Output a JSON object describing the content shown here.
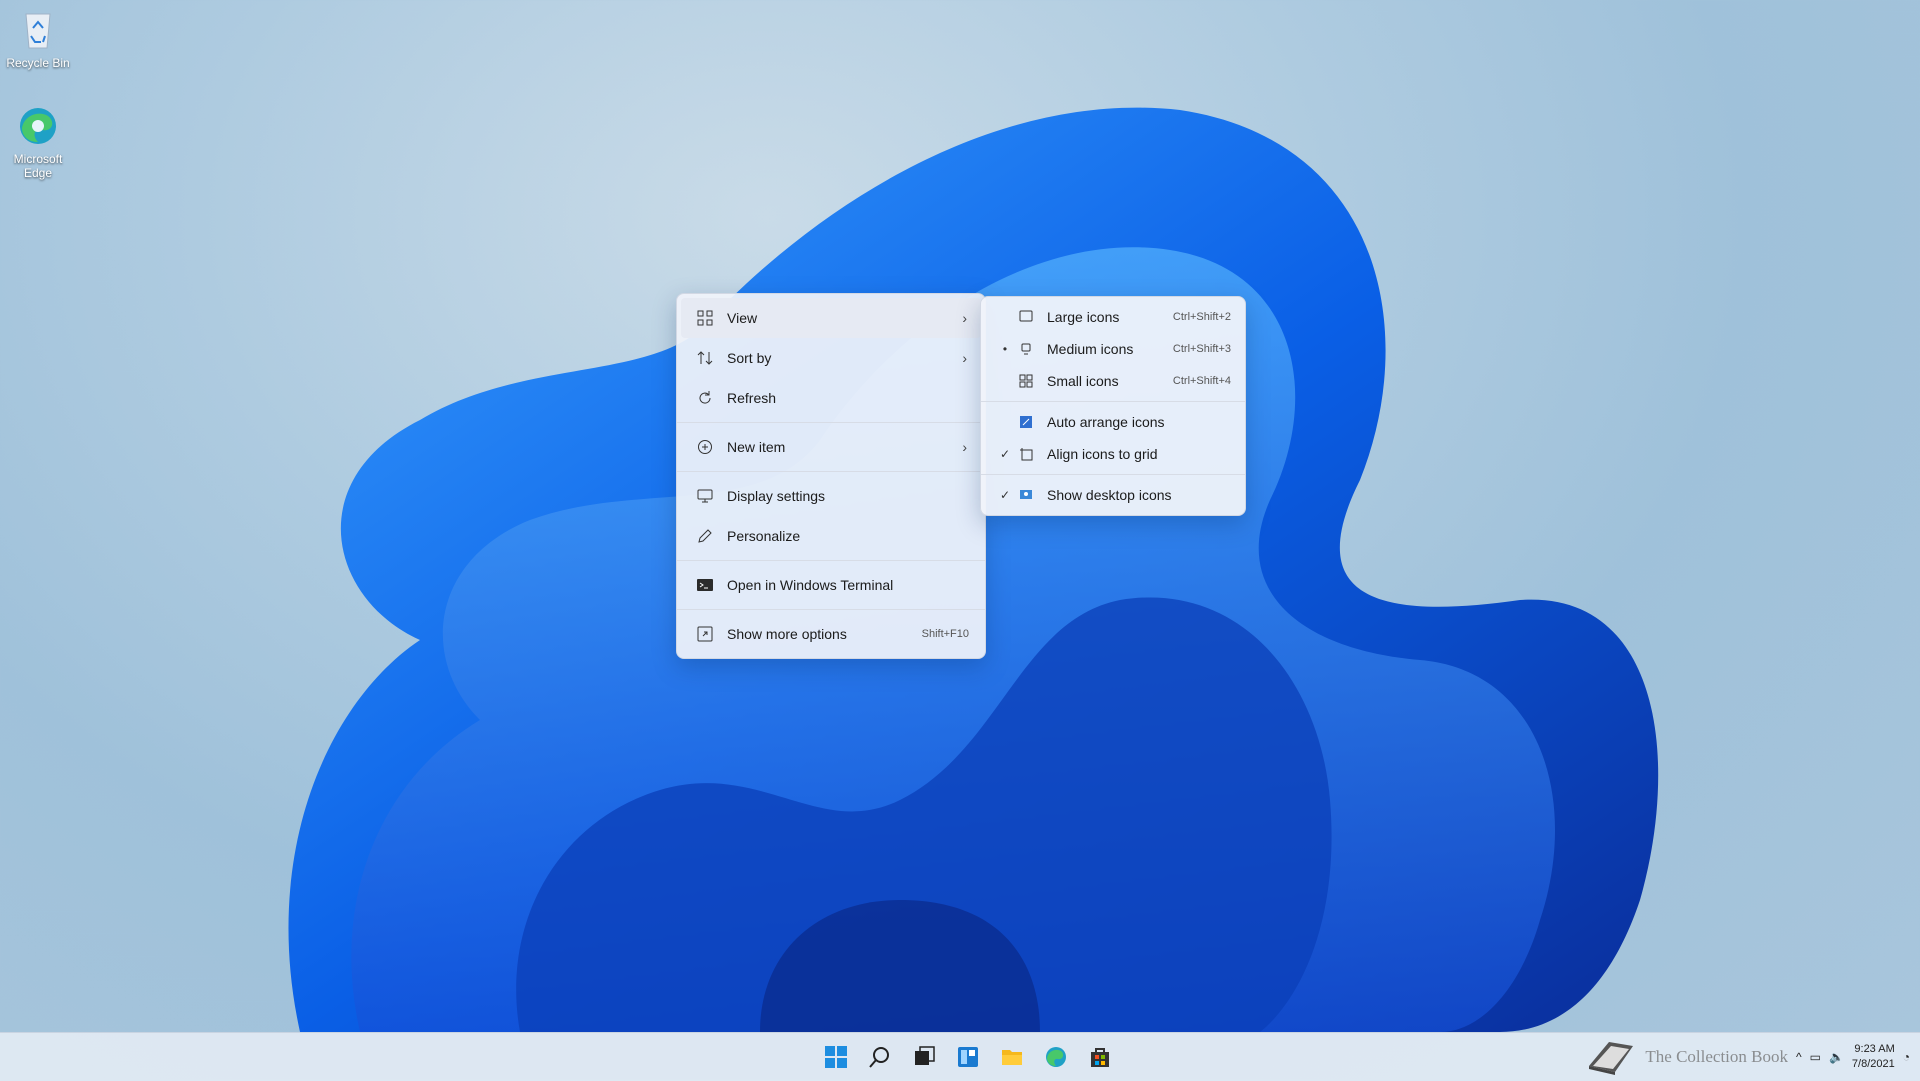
{
  "desktop": {
    "icons": [
      {
        "label": "Recycle Bin",
        "icon": "recycle-bin-icon"
      },
      {
        "label": "Microsoft Edge",
        "icon": "edge-icon"
      }
    ]
  },
  "context_menu": {
    "items": [
      {
        "label": "View",
        "icon": "grid-icon",
        "submenu": true
      },
      {
        "label": "Sort by",
        "icon": "sort-icon",
        "submenu": true
      },
      {
        "label": "Refresh",
        "icon": "refresh-icon"
      },
      {
        "label": "New item",
        "icon": "plus-circle-icon",
        "submenu": true
      },
      {
        "label": "Display settings",
        "icon": "display-icon"
      },
      {
        "label": "Personalize",
        "icon": "pen-icon"
      },
      {
        "label": "Open in Windows Terminal",
        "icon": "terminal-icon"
      },
      {
        "label": "Show more options",
        "icon": "more-options-icon",
        "shortcut": "Shift+F10"
      }
    ]
  },
  "view_submenu": {
    "items": [
      {
        "label": "Large icons",
        "shortcut": "Ctrl+Shift+2",
        "mark": ""
      },
      {
        "label": "Medium icons",
        "shortcut": "Ctrl+Shift+3",
        "mark": "•"
      },
      {
        "label": "Small icons",
        "shortcut": "Ctrl+Shift+4",
        "mark": ""
      },
      {
        "label": "Auto arrange icons",
        "mark": ""
      },
      {
        "label": "Align icons to grid",
        "mark": "✓"
      },
      {
        "label": "Show desktop icons",
        "mark": "✓"
      }
    ]
  },
  "taskbar": {
    "apps": [
      "start-icon",
      "search-icon",
      "task-view-icon",
      "widgets-icon",
      "file-explorer-icon",
      "edge-icon",
      "store-icon"
    ],
    "watermark": "The Collection Book",
    "time": "9:23 AM",
    "date": "7/8/2021"
  },
  "colors": {
    "accent": "#0a64e0",
    "menu_bg": "#f0f3fa"
  }
}
